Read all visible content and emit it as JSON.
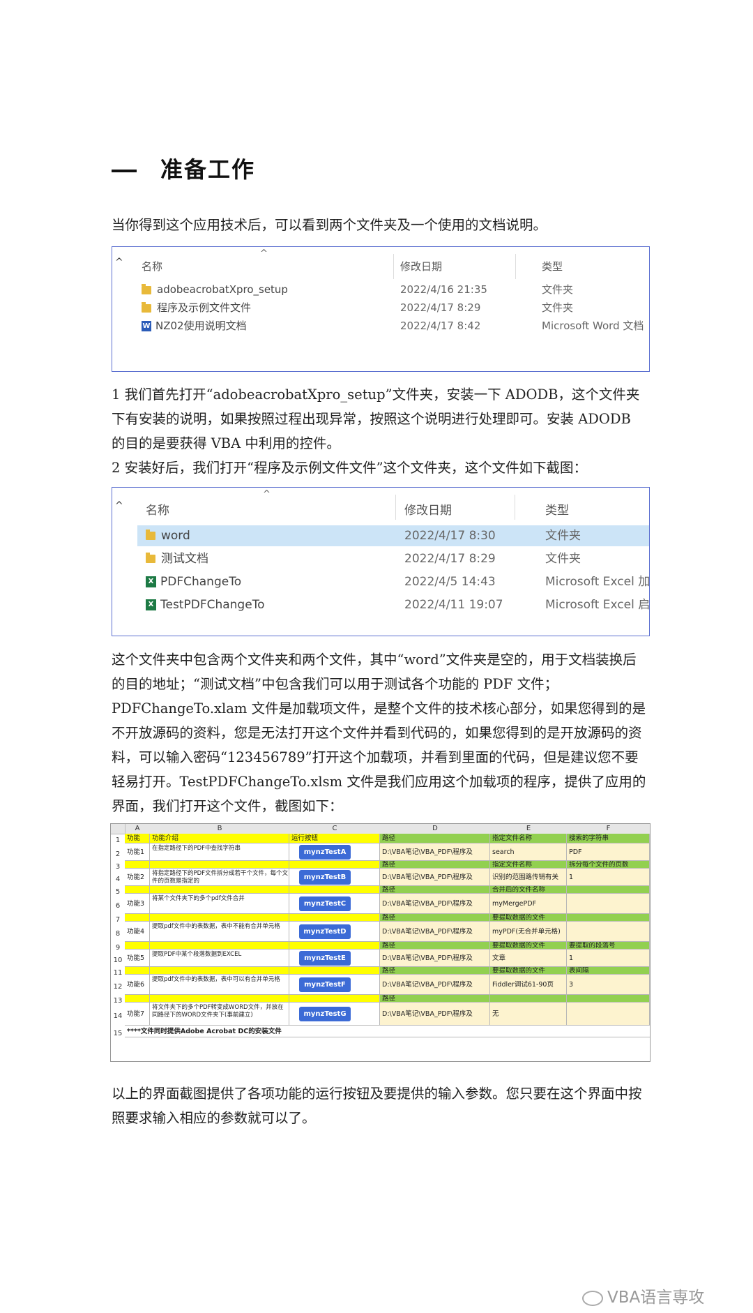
{
  "heading": {
    "number": "一",
    "title": "准备工作"
  },
  "intro": "当你得到这个应用技术后，可以看到两个文件夹及一个使用的文档说明。",
  "explorer1": {
    "columns": [
      "名称",
      "修改日期",
      "类型"
    ],
    "rows": [
      {
        "name": "adobeacrobatXpro_setup",
        "date": "2022/4/16 21:35",
        "type": "文件夹",
        "icon": "folder-icon"
      },
      {
        "name": "程序及示例文件文件",
        "date": "2022/4/17 8:29",
        "type": "文件夹",
        "icon": "folder-icon"
      },
      {
        "name": "NZ02使用说明文档",
        "date": "2022/4/17 8:42",
        "type": "Microsoft Word 文档",
        "icon": "word-icon"
      }
    ]
  },
  "para1": [
    "1 我们首先打开“adobeacrobatXpro_setup”文件夹，安装一下 ADODB，这个文件夹下有安装的说明，如果按照过程出现异常，按照这个说明进行处理即可。安装 ADODB 的目的是要获得 VBA 中利用的控件。",
    "2 安装好后，我们打开“程序及示例文件文件”这个文件夹，这个文件如下截图："
  ],
  "explorer2": {
    "columns": [
      "名称",
      "修改日期",
      "类型"
    ],
    "rows": [
      {
        "name": "word",
        "date": "2022/4/17 8:30",
        "type": "文件夹",
        "icon": "folder-icon",
        "selected": true
      },
      {
        "name": "测试文档",
        "date": "2022/4/17 8:29",
        "type": "文件夹",
        "icon": "folder-icon"
      },
      {
        "name": "PDFChangeTo",
        "date": "2022/4/5 14:43",
        "type": "Microsoft Excel 加...",
        "icon": "excel-icon"
      },
      {
        "name": "TestPDFChangeTo",
        "date": "2022/4/11 19:07",
        "type": "Microsoft Excel 启...",
        "icon": "excel-icon"
      }
    ]
  },
  "para2": [
    "这个文件夹中包含两个文件夹和两个文件，其中“word”文件夹是空的，用于文档装换后的目的地址；“测试文档”中包含我们可以用于测试各个功能的 PDF 文件；PDFChangeTo.xlam 文件是加载项文件，是整个文件的技术核心部分，如果您得到的是不开放源码的资料，您是无法打开这个文件并看到代码的，如果您得到的是开放源码的资料，可以输入密码“123456789”打开这个加载项，并看到里面的代码，但是建议您不要轻易打开。TestPDFChangeTo.xlsm 文件是我们应用这个加载项的程序，提供了应用的界面，我们打开这个文件，截图如下："
  ],
  "sheet": {
    "col_letters": [
      "A",
      "B",
      "C",
      "D",
      "E",
      "F"
    ],
    "header": [
      "功能",
      "功能介绍",
      "运行按钮",
      "路径",
      "指定文件名称",
      "搜索的字符串"
    ],
    "rows": [
      {
        "id": "功能1",
        "desc": "在指定路径下的PDF中查找字符串",
        "button": "mynzTestA",
        "path": "D:\\VBA笔记\\VBA_PDF\\程序及",
        "e": "search",
        "f": "PDF",
        "sub": [
          "路径",
          "指定文件名称",
          "拆分每个文件的页数"
        ]
      },
      {
        "id": "功能2",
        "desc": "将指定路径下的PDF文件拆分成若干个文件，每个文件的页数是指定的",
        "button": "mynzTestB",
        "path": "D:\\VBA笔记\\VBA_PDF\\程序及",
        "e": "识别的范围路传销有关",
        "f": "1",
        "sub": [
          "路径",
          "合并后的文件名称",
          ""
        ]
      },
      {
        "id": "功能3",
        "desc": "将某个文件夹下的多个pdf文件合并",
        "button": "mynzTestC",
        "path": "D:\\VBA笔记\\VBA_PDF\\程序及",
        "e": "myMergePDF",
        "f": "",
        "sub": [
          "路径",
          "要提取数据的文件",
          ""
        ]
      },
      {
        "id": "功能4",
        "desc": "提取pdf文件中的表数据，表中不能有合并单元格",
        "button": "mynzTestD",
        "path": "D:\\VBA笔记\\VBA_PDF\\程序及",
        "e": "myPDF(无合并单元格)",
        "f": "",
        "sub": [
          "路径",
          "要提取数据的文件",
          "要提取的段落号"
        ]
      },
      {
        "id": "功能5",
        "desc": "提取PDF中某个段落数据到EXCEL",
        "button": "mynzTestE",
        "path": "D:\\VBA笔记\\VBA_PDF\\程序及",
        "e": "文章",
        "f": "1",
        "sub": [
          "路径",
          "要提取数据的文件",
          "表间隔"
        ]
      },
      {
        "id": "功能6",
        "desc": "提取pdf文件中的表数据，表中可以有合并单元格",
        "button": "mynzTestF",
        "path": "D:\\VBA笔记\\VBA_PDF\\程序及",
        "e": "Fiddler调试61-90页",
        "f": "3",
        "sub": [
          "路径",
          "",
          ""
        ]
      },
      {
        "id": "功能7",
        "desc": "将文件夹下的多个PDF转变成WORD文件，并放在同路径下的WORD文件夹下(事前建立)",
        "button": "mynzTestG",
        "path": "D:\\VBA笔记\\VBA_PDF\\程序及",
        "e": "无",
        "f": ""
      }
    ],
    "footer": "****文件同时提供Adobe Acrobat DC的安装文件",
    "row_numbers": [
      "1",
      "2",
      "3",
      "4",
      "5",
      "6",
      "7",
      "8",
      "9",
      "10",
      "11",
      "12",
      "13",
      "14",
      "15"
    ]
  },
  "para3": "以上的界面截图提供了各项功能的运行按钮及要提供的输入参数。您只要在这个界面中按照要求输入相应的参数就可以了。",
  "watermark": "VBA语言専攻"
}
